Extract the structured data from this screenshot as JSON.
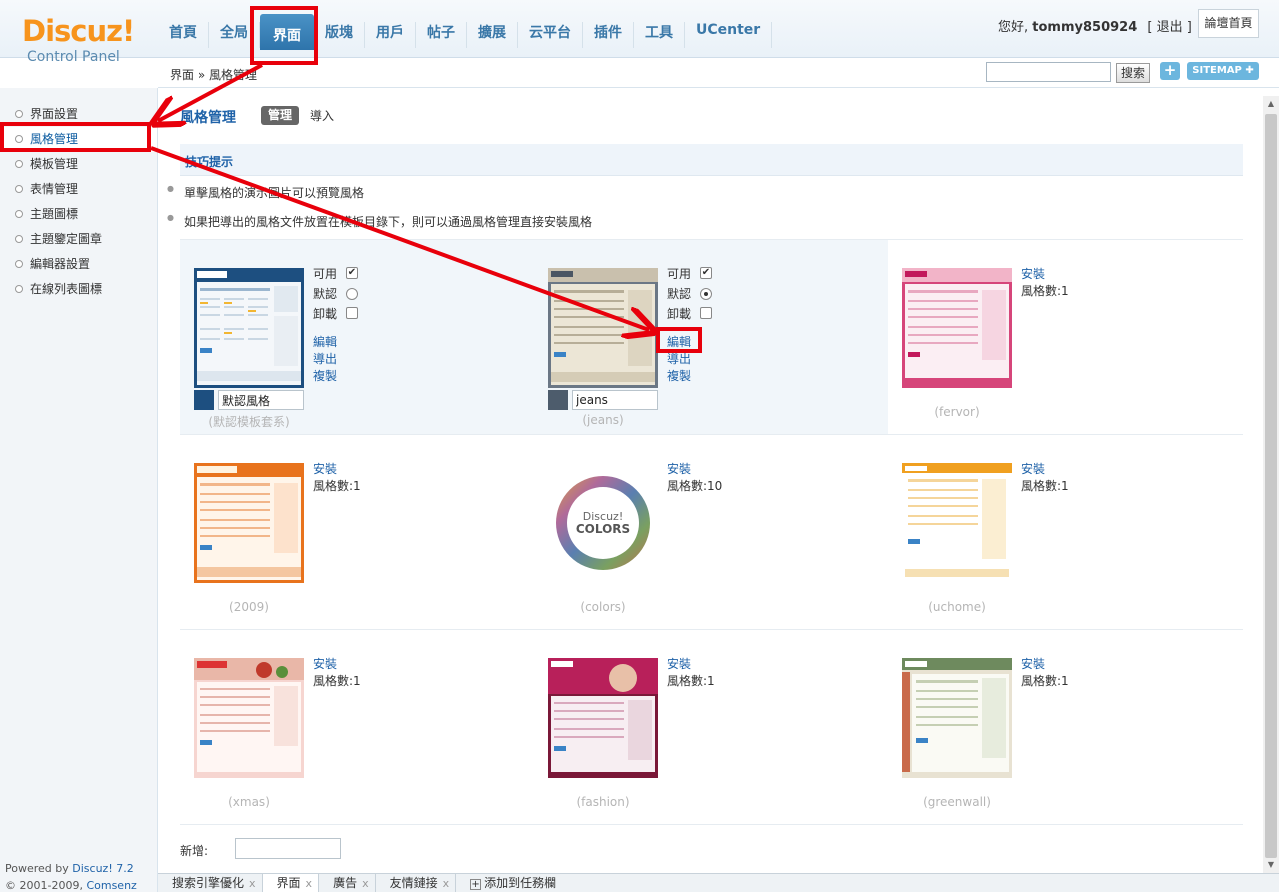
{
  "logo": {
    "brand": "Discuz!",
    "subtitle": "Control Panel"
  },
  "nav": {
    "items": [
      "首頁",
      "全局",
      "界面",
      "版塊",
      "用戶",
      "帖子",
      "擴展",
      "云平台",
      "插件",
      "工具",
      "UCenter"
    ],
    "active_index": 2
  },
  "user": {
    "greeting": "您好,",
    "username": "tommy850924",
    "logout": "[ 退出 ]",
    "forum_home": "論壇首頁"
  },
  "crumb": {
    "text": "界面 » 風格管理"
  },
  "search": {
    "button": "搜索",
    "plus": "+",
    "sitemap": "SITEMAP ✚"
  },
  "sidebar": {
    "items": [
      "界面設置",
      "風格管理",
      "模板管理",
      "表情管理",
      "主題圖標",
      "主題鑒定圖章",
      "編輯器設置",
      "在線列表圖標"
    ],
    "active_index": 1
  },
  "footer": {
    "powered_by": "Powered by",
    "powered_link": "Discuz! 7.2",
    "copyright": "© 2001-2009,",
    "company": "Comsenz Inc."
  },
  "page": {
    "title": "風格管理",
    "tab_manage": "管理",
    "tab_import": "導入"
  },
  "tips": {
    "title": "技巧提示",
    "items": [
      "單擊風格的演示圖片可以預覽風格",
      "如果把導出的風格文件放置在模板目錄下，則可以通過風格管理直接安裝風格"
    ]
  },
  "styles": [
    {
      "name": "(默認模板套系)",
      "installed": true,
      "enabled_label": "可用",
      "default_label": "默認",
      "uninstall_label": "卸載",
      "edit": "編輯",
      "export": "導出",
      "copy": "複製",
      "style_name": "默認風格",
      "is_default": true,
      "enabled": true,
      "swatch": "#1d4f80",
      "theme": "#1d4f80"
    },
    {
      "name": "(jeans)",
      "installed": true,
      "enabled_label": "可用",
      "default_label": "默認",
      "uninstall_label": "卸載",
      "edit": "編輯",
      "export": "導出",
      "copy": "複製",
      "style_name": "jeans",
      "is_default": true,
      "enabled": true,
      "swatch": "#4d5c6c",
      "theme": "#5b6b7a"
    },
    {
      "name": "(fervor)",
      "installed": false,
      "install": "安裝",
      "count": "風格數:1",
      "theme": "#d6457a"
    },
    {
      "name": "(2009)",
      "installed": false,
      "install": "安裝",
      "count": "風格數:1",
      "theme": "#e8731d"
    },
    {
      "name": "(colors)",
      "installed": false,
      "install": "安裝",
      "count": "風格數:10",
      "theme": "#888888",
      "logo_top": "Discuz!",
      "logo_bottom": "COLORS"
    },
    {
      "name": "(uchome)",
      "installed": false,
      "install": "安裝",
      "count": "風格數:1",
      "theme": "#f0a020"
    },
    {
      "name": "(xmas)",
      "installed": false,
      "install": "安裝",
      "count": "風格數:1",
      "theme": "#d34545"
    },
    {
      "name": "(fashion)",
      "installed": false,
      "install": "安裝",
      "count": "風格數:1",
      "theme": "#b8205a"
    },
    {
      "name": "(greenwall)",
      "installed": false,
      "install": "安裝",
      "count": "風格數:1",
      "theme": "#7a9a6a"
    }
  ],
  "new_style": {
    "label": "新增:"
  },
  "taskbar": {
    "items": [
      "搜索引擎優化",
      "界面",
      "廣告",
      "友情鏈接"
    ],
    "close": "x",
    "add": "添加到任務欄",
    "active_index": 1
  },
  "colors": {
    "accent": "#1f62a8",
    "nav_active": "#2e74ab",
    "annotation": "#e8000b"
  }
}
